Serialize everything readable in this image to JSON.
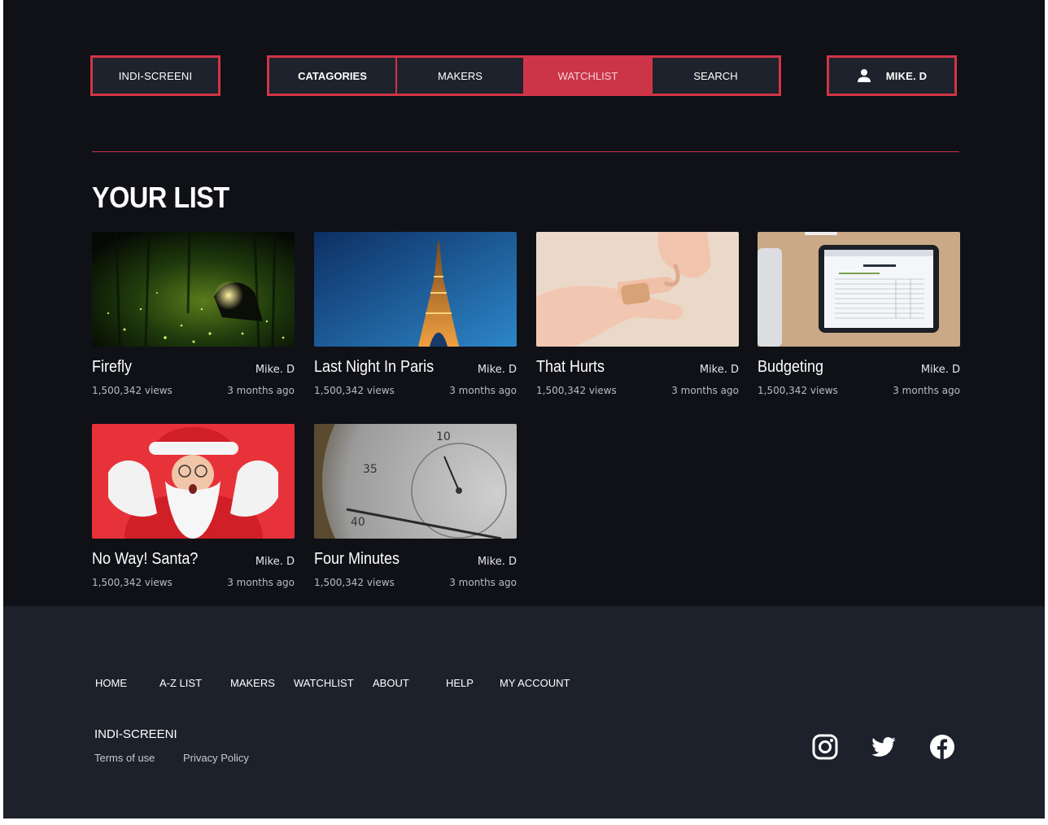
{
  "header": {
    "brand": "INDI-SCREENI",
    "nav": [
      {
        "label": "CATAGORIES"
      },
      {
        "label": "MAKERS"
      },
      {
        "label": "WATCHLIST"
      },
      {
        "label": "SEARCH"
      }
    ],
    "active_tab": "WATCHLIST",
    "user": {
      "name": "MIKE. D",
      "icon": "user-icon"
    }
  },
  "main": {
    "title": "YOUR LIST",
    "videos": [
      {
        "title": "Firefly",
        "author": "Mike. D",
        "views": "1,500,342 views",
        "time": "3 months ago",
        "thumbnail": "forest-night-lights"
      },
      {
        "title": "Last Night In Paris",
        "author": "Mike. D",
        "views": "1,500,342 views",
        "time": "3 months ago",
        "thumbnail": "eiffel-tower-dusk"
      },
      {
        "title": "That Hurts",
        "author": "Mike. D",
        "views": "1,500,342 views",
        "time": "3 months ago",
        "thumbnail": "bandaged-finger"
      },
      {
        "title": "Budgeting",
        "author": "Mike. D",
        "views": "1,500,342 views",
        "time": "3 months ago",
        "thumbnail": "tablet-spreadsheet"
      },
      {
        "title": "No Way! Santa?",
        "author": "Mike. D",
        "views": "1,500,342 views",
        "time": "3 months ago",
        "thumbnail": "surprised-santa"
      },
      {
        "title": "Four Minutes",
        "author": "Mike. D",
        "views": "1,500,342 views",
        "time": "3 months ago",
        "thumbnail": "watch-closeup"
      }
    ]
  },
  "footer": {
    "links": [
      "HOME",
      "A-Z LIST",
      "MAKERS",
      "WATCHLIST",
      "ABOUT",
      "HELP",
      "MY ACCOUNT"
    ],
    "brand": "INDI-SCREENI",
    "terms": "Terms of use",
    "privacy": "Privacy Policy",
    "social": [
      "instagram-icon",
      "twitter-icon",
      "facebook-icon"
    ]
  },
  "colors": {
    "background": "#0f1117",
    "footer": "#1d212b",
    "accent": "#d13446",
    "active_tab": "#cb3547"
  }
}
